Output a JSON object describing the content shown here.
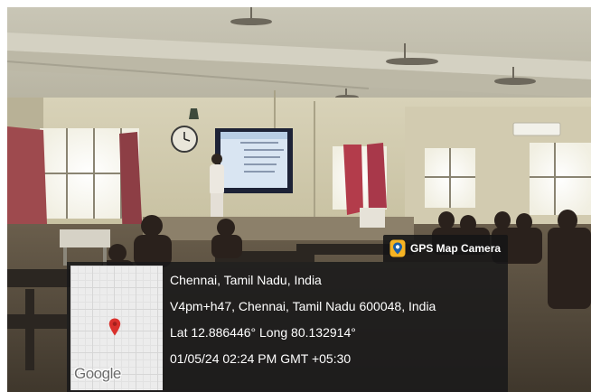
{
  "badge": {
    "label": "GPS Map Camera",
    "icon": "gps-camera-icon",
    "accent": "#f5b323"
  },
  "map": {
    "logo_text": "Google",
    "pin_icon": "location-pin-icon",
    "pin_color": "#d9302c"
  },
  "location": {
    "place": "Chennai, Tamil Nadu, India",
    "address": "V4pm+h47, Chennai, Tamil Nadu 600048, India",
    "coordinates": "Lat 12.886446° Long 80.132914°",
    "timestamp": "01/05/24 02:24 PM GMT +05:30"
  }
}
